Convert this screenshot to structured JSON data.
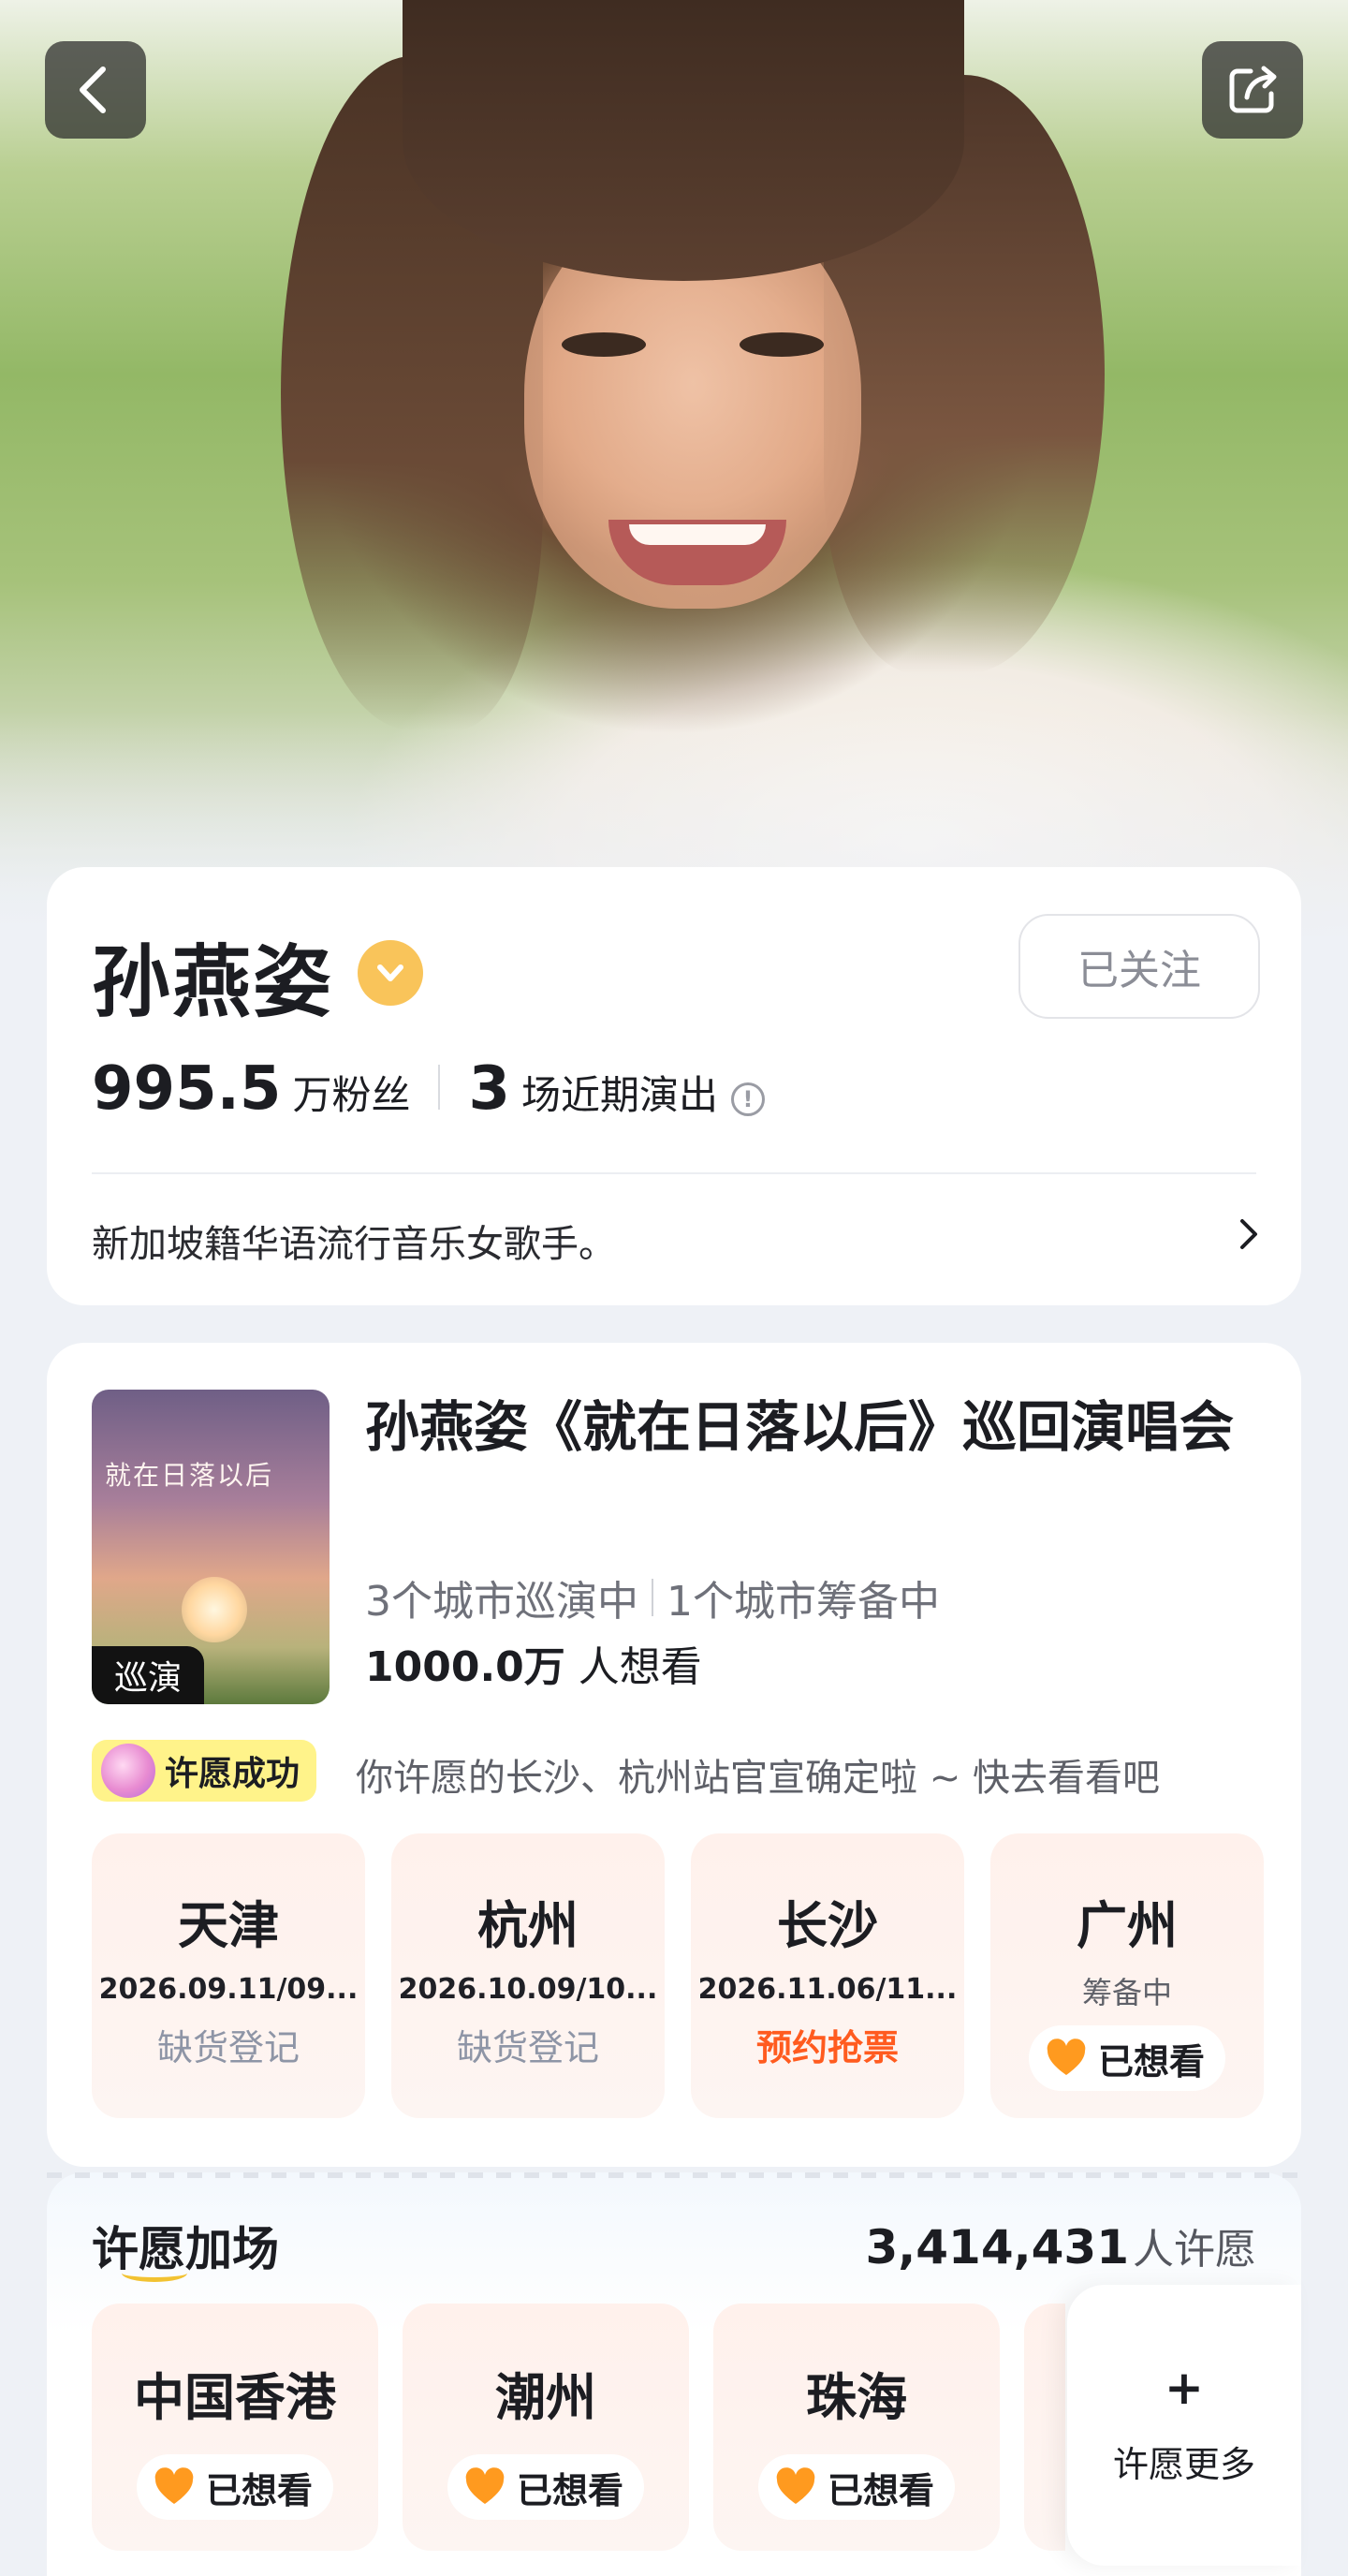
{
  "artist": {
    "name": "孙燕姿",
    "follow_label": "已关注",
    "fans_value": "995.5",
    "fans_unit": "万粉丝",
    "shows_value": "3",
    "shows_unit": "场近期演出",
    "bio": "新加坡籍华语流行音乐女歌手。"
  },
  "tour": {
    "poster_title": "就在日落以后",
    "poster_tag": "巡演",
    "title": "孙燕姿《就在日落以后》巡回演唱会",
    "touring": "3个城市巡演中",
    "preparing": "1个城市筹备中",
    "want_value": "1000.0万",
    "want_unit": "人想看",
    "wish_badge": "许愿成功",
    "wish_message": "你许愿的长沙、杭州站官宣确定啦 ~ 快去看看吧",
    "cities": [
      {
        "name": "天津",
        "date": "2026.09.11/09...",
        "action": "缺货登记"
      },
      {
        "name": "杭州",
        "date": "2026.10.09/10...",
        "action": "缺货登记"
      },
      {
        "name": "长沙",
        "date": "2026.11.06/11...",
        "action": "预约抢票"
      },
      {
        "name": "广州",
        "sub": "筹备中",
        "wanted": "已想看"
      }
    ]
  },
  "wish_more": {
    "title": "许愿加场",
    "count": "3,414,431",
    "count_unit": "人许愿",
    "cities": [
      {
        "name": "中国香港",
        "wanted": "已想看"
      },
      {
        "name": "潮州",
        "wanted": "已想看"
      },
      {
        "name": "珠海",
        "wanted": "已想看"
      }
    ],
    "more_label": "许愿更多"
  },
  "colors": {
    "hot_action": "#ff5b1f",
    "muted_action": "#8e95a6",
    "verified": "#f9c45a",
    "wish_badge": "#fff38a",
    "heart": "#ff9a1f"
  }
}
